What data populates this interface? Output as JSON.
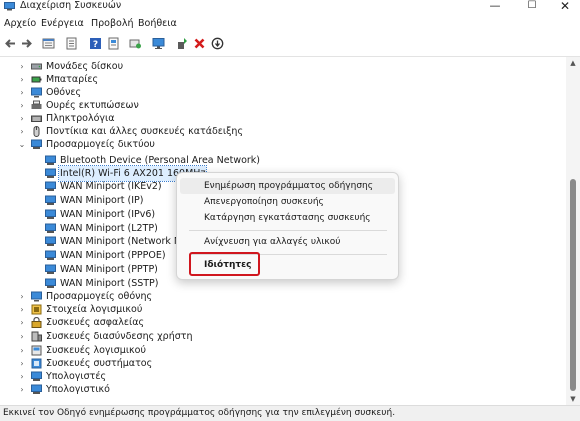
{
  "window": {
    "title": "Διαχείριση Συσκευών",
    "controls": {
      "minimize": "—",
      "maximize": "☐",
      "close": "✕"
    }
  },
  "menubar": [
    "Αρχείο",
    "Ενέργεια",
    "Προβολή",
    "Βοήθεια"
  ],
  "toolbar_icons": [
    "back-arrow-icon",
    "forward-arrow-icon",
    "device-view-icon",
    "properties-icon",
    "help-icon",
    "resources-icon",
    "scan-hardware-icon",
    "monitor-icon",
    "update-driver-icon",
    "uninstall-icon",
    "disable-icon"
  ],
  "tree": [
    {
      "label": "Μονάδες δίσκου",
      "expanded": false,
      "icon": "disk-drive-icon"
    },
    {
      "label": "Μπαταρίες",
      "expanded": false,
      "icon": "battery-icon"
    },
    {
      "label": "Οθόνες",
      "expanded": false,
      "icon": "monitor-icon"
    },
    {
      "label": "Ουρές εκτυπώσεων",
      "expanded": false,
      "icon": "printer-icon"
    },
    {
      "label": "Πληκτρολόγια",
      "expanded": false,
      "icon": "keyboard-icon"
    },
    {
      "label": "Ποντίκια και άλλες συσκευές κατάδειξης",
      "expanded": false,
      "icon": "mouse-icon"
    },
    {
      "label": "Προσαρμογείς δικτύου",
      "expanded": true,
      "icon": "network-adapter-icon",
      "children": [
        {
          "label": "Bluetooth Device (Personal Area Network)",
          "selected": false
        },
        {
          "label": "Intel(R) Wi-Fi 6 AX201 160MHz",
          "selected": true
        },
        {
          "label": "WAN Miniport (IKEv2)",
          "selected": false
        },
        {
          "label": "WAN Miniport (IP)",
          "selected": false
        },
        {
          "label": "WAN Miniport (IPv6)",
          "selected": false
        },
        {
          "label": "WAN Miniport (L2TP)",
          "selected": false
        },
        {
          "label": "WAN Miniport (Network Monitor)",
          "selected": false
        },
        {
          "label": "WAN Miniport (PPPOE)",
          "selected": false
        },
        {
          "label": "WAN Miniport (PPTP)",
          "selected": false
        },
        {
          "label": "WAN Miniport (SSTP)",
          "selected": false
        }
      ]
    },
    {
      "label": "Προσαρμογείς οθόνης",
      "expanded": false,
      "icon": "display-adapter-icon"
    },
    {
      "label": "Στοιχεία λογισμικού",
      "expanded": false,
      "icon": "software-component-icon"
    },
    {
      "label": "Συσκευές ασφαλείας",
      "expanded": false,
      "icon": "security-device-icon"
    },
    {
      "label": "Συσκευές διασύνδεσης χρήστη",
      "expanded": false,
      "icon": "hid-icon"
    },
    {
      "label": "Συσκευές λογισμικού",
      "expanded": false,
      "icon": "software-device-icon"
    },
    {
      "label": "Συσκευές συστήματος",
      "expanded": false,
      "icon": "system-device-icon"
    },
    {
      "label": "Υπολογιστές",
      "expanded": false,
      "icon": "computer-icon"
    },
    {
      "label": "Υπολογιστικό",
      "expanded": false,
      "icon": "computer-icon"
    }
  ],
  "context_menu": {
    "items": [
      {
        "label": "Ενημέρωση προγράμματος οδήγησης",
        "hover": true
      },
      {
        "label": "Απενεργοποίηση συσκευής"
      },
      {
        "label": "Κατάργηση εγκατάστασης συσκευής"
      },
      {
        "label": "Ανίχνευση για αλλαγές υλικού"
      },
      {
        "label": "Ιδιότητες",
        "bold": true,
        "highlighted": true
      }
    ]
  },
  "status_text": "Εκκινεί τον Οδηγό ενημέρωσης προγράμματος οδήγησης για την επιλεγμένη συσκευή.",
  "colors": {
    "accent": "#2c6fca",
    "highlight_box": "#d0161e",
    "selection": "#ddeeff"
  }
}
